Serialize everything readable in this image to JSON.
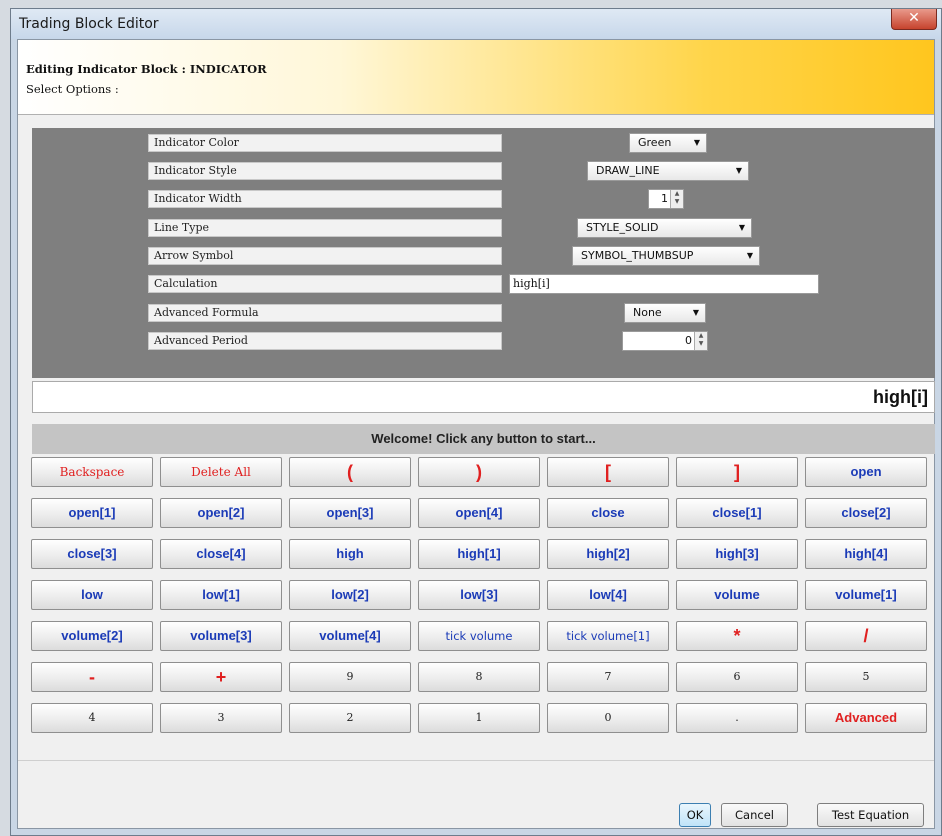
{
  "window": {
    "title": "Trading Block Editor",
    "close_glyph": "✕"
  },
  "header": {
    "title": "Editing Indicator Block : INDICATOR",
    "subtitle": "Select Options :"
  },
  "options": {
    "indicator_color": {
      "label": "Indicator Color",
      "value": "Green"
    },
    "indicator_style": {
      "label": "Indicator Style",
      "value": "DRAW_LINE"
    },
    "indicator_width": {
      "label": "Indicator Width",
      "value": "1"
    },
    "line_type": {
      "label": "Line Type",
      "value": "STYLE_SOLID"
    },
    "arrow_symbol": {
      "label": "Arrow Symbol",
      "value": "SYMBOL_THUMBSUP"
    },
    "calculation": {
      "label": "Calculation",
      "value": "high[i]"
    },
    "advanced_formula": {
      "label": "Advanced Formula",
      "value": "None"
    },
    "advanced_period": {
      "label": "Advanced Period",
      "value": "0"
    }
  },
  "display": {
    "value": "high[i]"
  },
  "status": {
    "welcome": "Welcome! Click any button to start..."
  },
  "keypad": {
    "rows": [
      [
        "Backspace",
        "Delete All",
        "(",
        ")",
        "[",
        "]",
        "open"
      ],
      [
        "open[1]",
        "open[2]",
        "open[3]",
        "open[4]",
        "close",
        "close[1]",
        "close[2]"
      ],
      [
        "close[3]",
        "close[4]",
        "high",
        "high[1]",
        "high[2]",
        "high[3]",
        "high[4]"
      ],
      [
        "low",
        "low[1]",
        "low[2]",
        "low[3]",
        "low[4]",
        "volume",
        "volume[1]"
      ],
      [
        "volume[2]",
        "volume[3]",
        "volume[4]",
        "tick volume",
        "tick volume[1]",
        "*",
        "/"
      ],
      [
        "-",
        "+",
        "9",
        "8",
        "7",
        "6",
        "5"
      ],
      [
        "4",
        "3",
        "2",
        "1",
        "0",
        ".",
        "Advanced"
      ]
    ],
    "styles": [
      [
        "red-plain",
        "red-plain",
        "red big",
        "red big",
        "red big",
        "red big",
        ""
      ],
      [
        "",
        "",
        "",
        "",
        "",
        "",
        ""
      ],
      [
        "",
        "",
        "",
        "",
        "",
        "",
        ""
      ],
      [
        "",
        "",
        "",
        "",
        "",
        "",
        ""
      ],
      [
        "",
        "",
        "",
        "blue-plain",
        "blue-plain",
        "red big",
        "red big"
      ],
      [
        "red big",
        "red big",
        "black",
        "black",
        "black",
        "black",
        "black"
      ],
      [
        "black",
        "black",
        "black",
        "black",
        "black",
        "black",
        "red"
      ]
    ]
  },
  "buttons": {
    "ok": "OK",
    "cancel": "Cancel",
    "test": "Test Equation"
  },
  "colors": {
    "key_text_blue": "#1b3bb7",
    "key_text_red": "#e02020",
    "options_panel": "#7f7f7f",
    "header_gold": "#ffc61e"
  }
}
